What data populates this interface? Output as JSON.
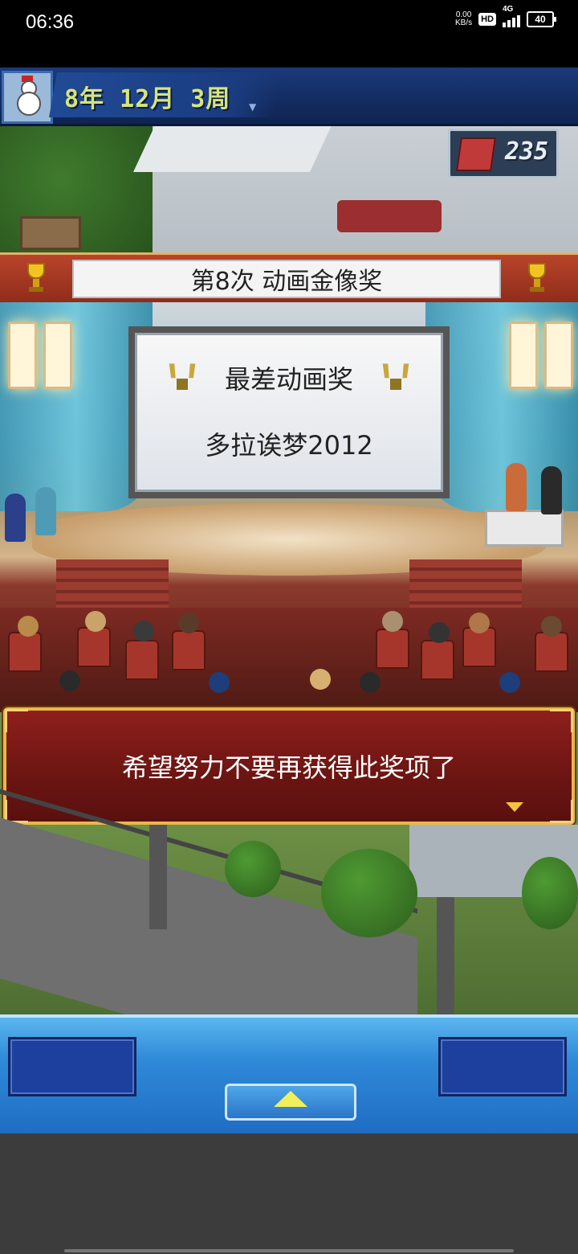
{
  "status_bar": {
    "time": "06:36",
    "net_speed_value": "0.00",
    "net_speed_unit": "KB/s",
    "hd_label": "HD",
    "network_label": "4G",
    "battery": "40"
  },
  "game": {
    "date": "8年 12月 3周",
    "money": "235",
    "award_title": "第8次 动画金像奖",
    "award_category": "最差动画奖",
    "nominee": "多拉诶梦2012",
    "dialog_message": "希望努力不要再获得此奖项了"
  },
  "colors": {
    "dialog_bg": "#7a1a16",
    "dialog_border": "#e9b74a",
    "control_bar": "#2f8ad8",
    "date_text": "#d6e57a"
  }
}
